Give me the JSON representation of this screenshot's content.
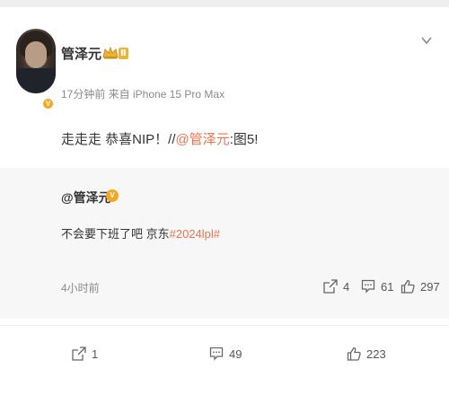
{
  "post": {
    "author": "管泽元",
    "level": "Ⅱ",
    "verified_mark": "V",
    "meta": "17分钟前 来自 iPhone 15 Pro Max",
    "text_prefix": "走走走 恭喜NIP！//",
    "mention": "@管泽元",
    "text_suffix": ":图5!"
  },
  "repost": {
    "author": "@管泽元",
    "verified_mark": "V",
    "text_prefix": "不会要下班了吧 京东",
    "hashtag": "#2024lpl#",
    "time": "4小时前",
    "share_count": "4",
    "comment_count": "61",
    "like_count": "297"
  },
  "actions": {
    "share_count": "1",
    "comment_count": "49",
    "like_count": "223"
  },
  "colors": {
    "link": "#eb7350",
    "badge": "#f5a623",
    "level_badge": "#e9b43a",
    "repost_bg": "#f7f7f8"
  },
  "icons": [
    "chevron-down-icon",
    "crown-icon",
    "share-icon",
    "comment-icon",
    "like-icon"
  ]
}
